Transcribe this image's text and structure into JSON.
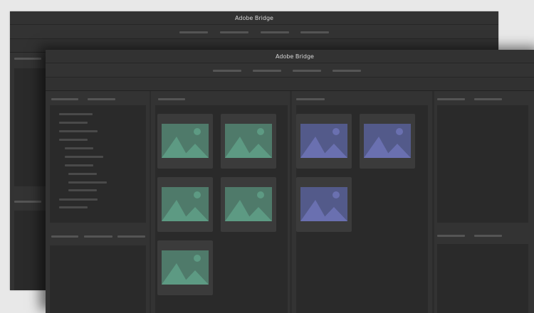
{
  "back_window": {
    "title": "Adobe Bridge"
  },
  "front_window": {
    "title": "Adobe Bridge"
  },
  "colors": {
    "green_thumb_bg": "#4f7a6a",
    "green_thumb_fg": "#5d9a83",
    "purple_thumb_bg": "#535a8a",
    "purple_thumb_fg": "#6a70b0"
  },
  "thumbnails": {
    "green_count": 5,
    "purple_count": 3,
    "icon": "image-placeholder-icon"
  }
}
